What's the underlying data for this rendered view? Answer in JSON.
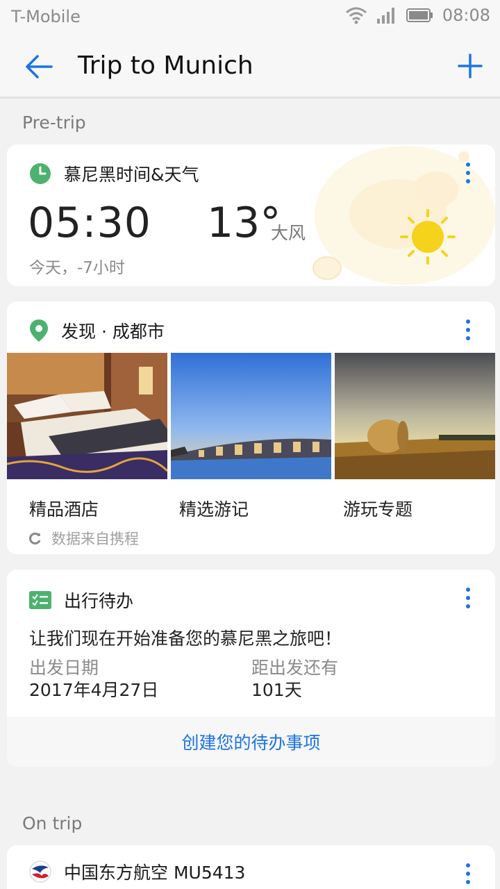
{
  "status": {
    "carrier": "T-Mobile",
    "time": "08:08"
  },
  "appbar": {
    "title": "Trip to Munich"
  },
  "sections": {
    "pre": "Pre-trip",
    "on": "On trip"
  },
  "weather": {
    "title": "慕尼黑时间&天气",
    "time": "05:30",
    "temp": "13°",
    "condition": "大风",
    "sub": "今天，-7小时"
  },
  "discover": {
    "title": "发现 · 成都市",
    "items": [
      {
        "label": "精品酒店"
      },
      {
        "label": "精选游记"
      },
      {
        "label": "游玩专题"
      }
    ],
    "source": "数据来自携程"
  },
  "todo": {
    "title": "出行待办",
    "message": "让我们现在开始准备您的慕尼黑之旅吧！",
    "depart_label": "出发日期",
    "depart_value": "2017年4月27日",
    "countdown_label": "距出发还有",
    "countdown_value": "101天",
    "action": "创建您的待办事项"
  },
  "flight": {
    "title": "中国东方航空 MU5413"
  },
  "colors": {
    "accent": "#1a73e8",
    "green": "#4cb26e",
    "sun": "#f5d31a"
  }
}
